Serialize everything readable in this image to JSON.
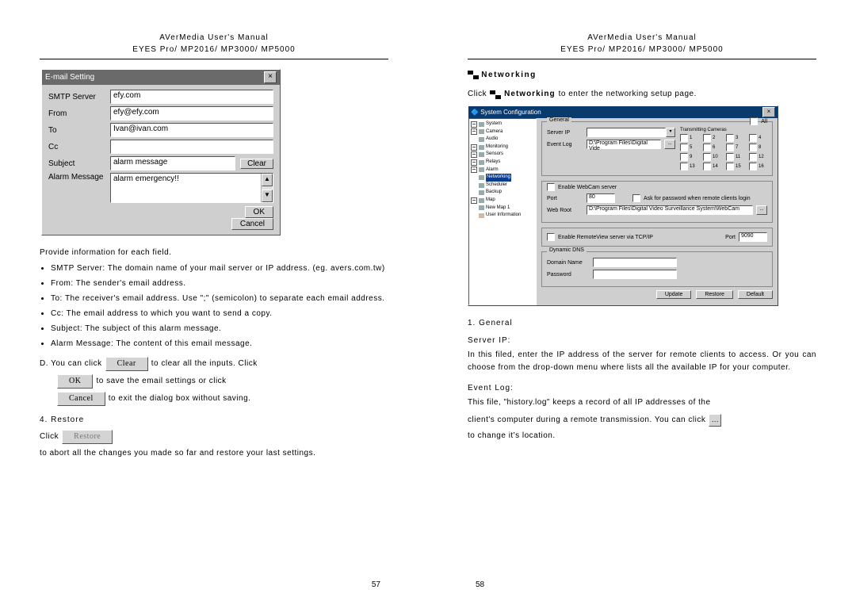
{
  "header": {
    "line1": "AVerMedia User's Manual",
    "line2": "EYES Pro/ MP2016/ MP3000/ MP5000"
  },
  "left": {
    "pagenum": "57",
    "email_dialog": {
      "title": "E-mail Setting",
      "labels": {
        "smtp": "SMTP Server",
        "from": "From",
        "to": "To",
        "cc": "Cc",
        "subject": "Subject",
        "alarm": "Alarm Message"
      },
      "values": {
        "smtp": "efy.com",
        "from": "efy@efy.com",
        "to": "Ivan@ivan.com",
        "cc": "",
        "subject": "alarm message",
        "alarm": "alarm emergency!!"
      },
      "buttons": {
        "clear": "Clear",
        "ok": "OK",
        "cancel": "Cancel"
      }
    },
    "intro": "Provide information for each field.",
    "bullets": [
      "SMTP Server: The domain name of your mail server or IP address. (eg. avers.com.tw)",
      "From: The sender's email address.",
      "To: The receiver's email address. Use \";\" (semicolon) to separate each email address.",
      "Cc: The email address to which you want to send a copy.",
      "Subject: The subject of this alarm message.",
      "Alarm Message: The content of this email message."
    ],
    "stepD": {
      "pre": "D.  You can click",
      "clear": "Clear",
      "mid": "to clear all the inputs.  Click",
      "ok": "OK",
      "mid2": "to save the email settings or click",
      "cancel": "Cancel",
      "post": "to exit the dialog box without saving."
    },
    "restore": {
      "heading": "4.  Restore",
      "pre": "Click",
      "btn": "Restore",
      "post": "to abort all the changes you made so far and restore your last settings."
    }
  },
  "right": {
    "pagenum": "58",
    "net_heading": "Networking",
    "click_line": {
      "pre": "Click",
      "label": "Networking",
      "post": "to enter the networking setup page."
    },
    "syswin": {
      "title": "System Configuration",
      "tree": [
        "System",
        "Camera",
        "Audio",
        "Monitoring",
        "Sensors",
        "Relays",
        "Alarm",
        "Networking",
        "Scheduler",
        "Backup",
        "Map",
        "New Map 1",
        "User Information"
      ],
      "general": {
        "label": "General",
        "all": "All",
        "server_ip": "Server IP",
        "server_ip_value": "",
        "event_log": "Event Log",
        "event_log_value": "D:\\Program Files\\Digital Vide",
        "trans_cams": "Transmitting Cameras",
        "cams": [
          "1",
          "2",
          "3",
          "4",
          "5",
          "6",
          "7",
          "8",
          "9",
          "10",
          "11",
          "12",
          "13",
          "14",
          "15",
          "16"
        ]
      },
      "webcam": {
        "enable": "Enable WebCam server",
        "port": "Port",
        "port_value": "80",
        "ask": "Ask for password when remote clients login",
        "webroot": "Web Root",
        "webroot_value": "D:\\Program Files\\Digital Video Surveillance System\\WebCam"
      },
      "remoteview": {
        "enable": "Enable RemoteView server via TCP/IP",
        "port": "Port",
        "port_value": "9090"
      },
      "ddns": {
        "label": "Dynamic DNS",
        "domain": "Domain Name",
        "domain_value": "",
        "password": "Password",
        "password_value": ""
      },
      "buttons": {
        "update": "Update",
        "restore": "Restore",
        "default": "Default"
      }
    },
    "section1": {
      "heading": "1.  General",
      "serverip_label": "Server IP:",
      "serverip_text": "In this filed, enter the IP address of the server for remote clients to access.  Or you can choose from the drop-down menu where lists all the available IP for your computer.",
      "eventlog_label": "Event Log:",
      "eventlog_text1": "This file, \"history.log\" keeps a record of all IP addresses of the",
      "eventlog_text2_pre": "client's computer during a remote transmission.  You can click",
      "eventlog_text2_post": "to change it's location."
    }
  }
}
